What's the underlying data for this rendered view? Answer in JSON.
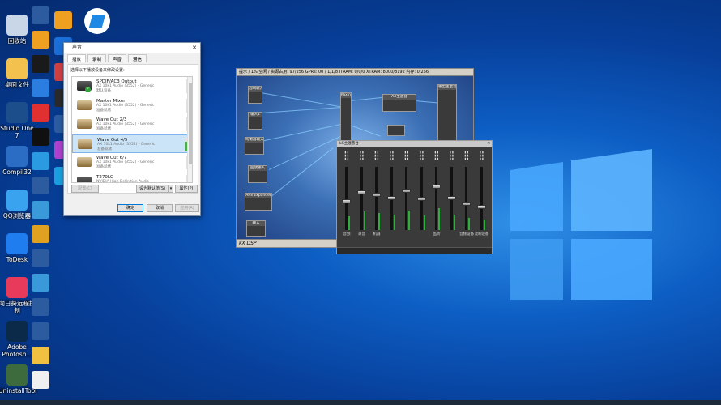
{
  "desktop": {
    "left_column": [
      {
        "label": "回收站",
        "color": "#c9d6e8"
      },
      {
        "label": "桌面文件",
        "color": "#f2c14e"
      },
      {
        "label": "Studio One 7",
        "color": "#1b4e8a"
      },
      {
        "label": "Compil32",
        "color": "#2b6cc4"
      },
      {
        "label": "QQ浏览器",
        "color": "#3aa3f0"
      },
      {
        "label": "ToDesk",
        "color": "#1f7df0"
      },
      {
        "label": "向日葵远程控制",
        "color": "#e83a5a"
      },
      {
        "label": "Adobe Photosh...",
        "color": "#0b2a4a"
      },
      {
        "label": "UninstallTool",
        "color": "#3d6b3d"
      }
    ],
    "second_column": [
      {
        "label": "",
        "color": "#2c5ba0"
      },
      {
        "label": "",
        "color": "#f0a020"
      },
      {
        "label": "",
        "color": "#1a1a1a"
      },
      {
        "label": "",
        "color": "#2c7de0"
      },
      {
        "label": "",
        "color": "#e03030"
      },
      {
        "label": "",
        "color": "#101010"
      },
      {
        "label": "",
        "color": "#2a9be0"
      },
      {
        "label": "",
        "color": "#2c5ba0"
      },
      {
        "label": "",
        "color": "#3a9ad9"
      },
      {
        "label": "",
        "color": "#e0a020"
      },
      {
        "label": "",
        "color": "#2c5ba0"
      },
      {
        "label": "",
        "color": "#3a9ad9"
      },
      {
        "label": "",
        "color": "#2c5ba0"
      },
      {
        "label": "",
        "color": "#2c5ba0"
      },
      {
        "label": "",
        "color": "#f0c040"
      },
      {
        "label": "",
        "color": "#f0f0f0"
      }
    ],
    "third_column": [
      {
        "label": "",
        "color": "#f0a020"
      },
      {
        "label": "",
        "color": "#1a6fd8"
      },
      {
        "label": "",
        "color": "#d04040"
      },
      {
        "label": "",
        "color": "#2a2a2a"
      },
      {
        "label": "",
        "color": "#2c5ba0"
      },
      {
        "label": "",
        "color": "#b040d0"
      },
      {
        "label": "",
        "color": "#1aa0e0"
      }
    ]
  },
  "sound_dialog": {
    "title": "声音",
    "tabs": [
      "播放",
      "录制",
      "声音",
      "通信"
    ],
    "instruction": "选择以下播放设备来修改设置:",
    "devices": [
      {
        "name": "SPDIF/AC3 Output",
        "sub1": "AX 10k1 Audio (3552) - Generic",
        "sub2": "默认设备",
        "dark": true,
        "default": true,
        "selected": false,
        "active_meter": false
      },
      {
        "name": "Master Mixer",
        "sub1": "AX 10k1 Audio (3552) - Generic",
        "sub2": "准备就绪",
        "dark": false,
        "default": false,
        "selected": false,
        "active_meter": false
      },
      {
        "name": "Wave Out 2/3",
        "sub1": "AX 10k1 Audio (3552) - Generic",
        "sub2": "准备就绪",
        "dark": false,
        "default": false,
        "selected": false,
        "active_meter": false
      },
      {
        "name": "Wave Out 4/5",
        "sub1": "AX 10k1 Audio (3552) - Generic",
        "sub2": "准备就绪",
        "dark": false,
        "default": false,
        "selected": true,
        "active_meter": true
      },
      {
        "name": "Wave Out 6/7",
        "sub1": "AX 10k1 Audio (3552) - Generic",
        "sub2": "准备就绪",
        "dark": false,
        "default": false,
        "selected": false,
        "active_meter": false
      },
      {
        "name": "T270LG",
        "sub1": "NVIDIA High Definition Audio",
        "sub2": "",
        "dark": true,
        "default": false,
        "selected": false,
        "active_meter": false
      }
    ],
    "configure_button": "配置(C)",
    "set_default_button": "设为默认值(S)",
    "properties_button": "属性(P)",
    "ok_button": "确定",
    "cancel_button": "取消",
    "apply_button": "应用(A)"
  },
  "dsp_window": {
    "title": "kX DSP",
    "title_bar": "提示 / 1% 空闲 / 资源占用: 97/256  GPRs: 00 / 1/1/8  ITRAM: 0/0/0  XTRAM: 8000/8192  内存: 0/256",
    "nodes": [
      "混响输入",
      "输入1",
      "均衡器输入",
      "APS Expander",
      "Mixin",
      "AX主混音",
      "回放输入",
      "输入",
      "输出主混音"
    ],
    "mixer_labels": [
      "SPDIF",
      "Mix",
      "Wave",
      "Rec",
      "FX",
      "Amp",
      "Aux"
    ]
  },
  "mixer_window": {
    "title": "kX主混音台",
    "channel_labels": [
      "音频",
      "录音",
      "机器",
      "",
      "",
      "",
      "监听",
      "",
      "音频设备",
      "混响设备"
    ],
    "fader_levels": [
      0.45,
      0.6,
      0.55,
      0.5,
      0.62,
      0.48,
      0.7,
      0.5,
      0.4,
      0.35
    ]
  }
}
